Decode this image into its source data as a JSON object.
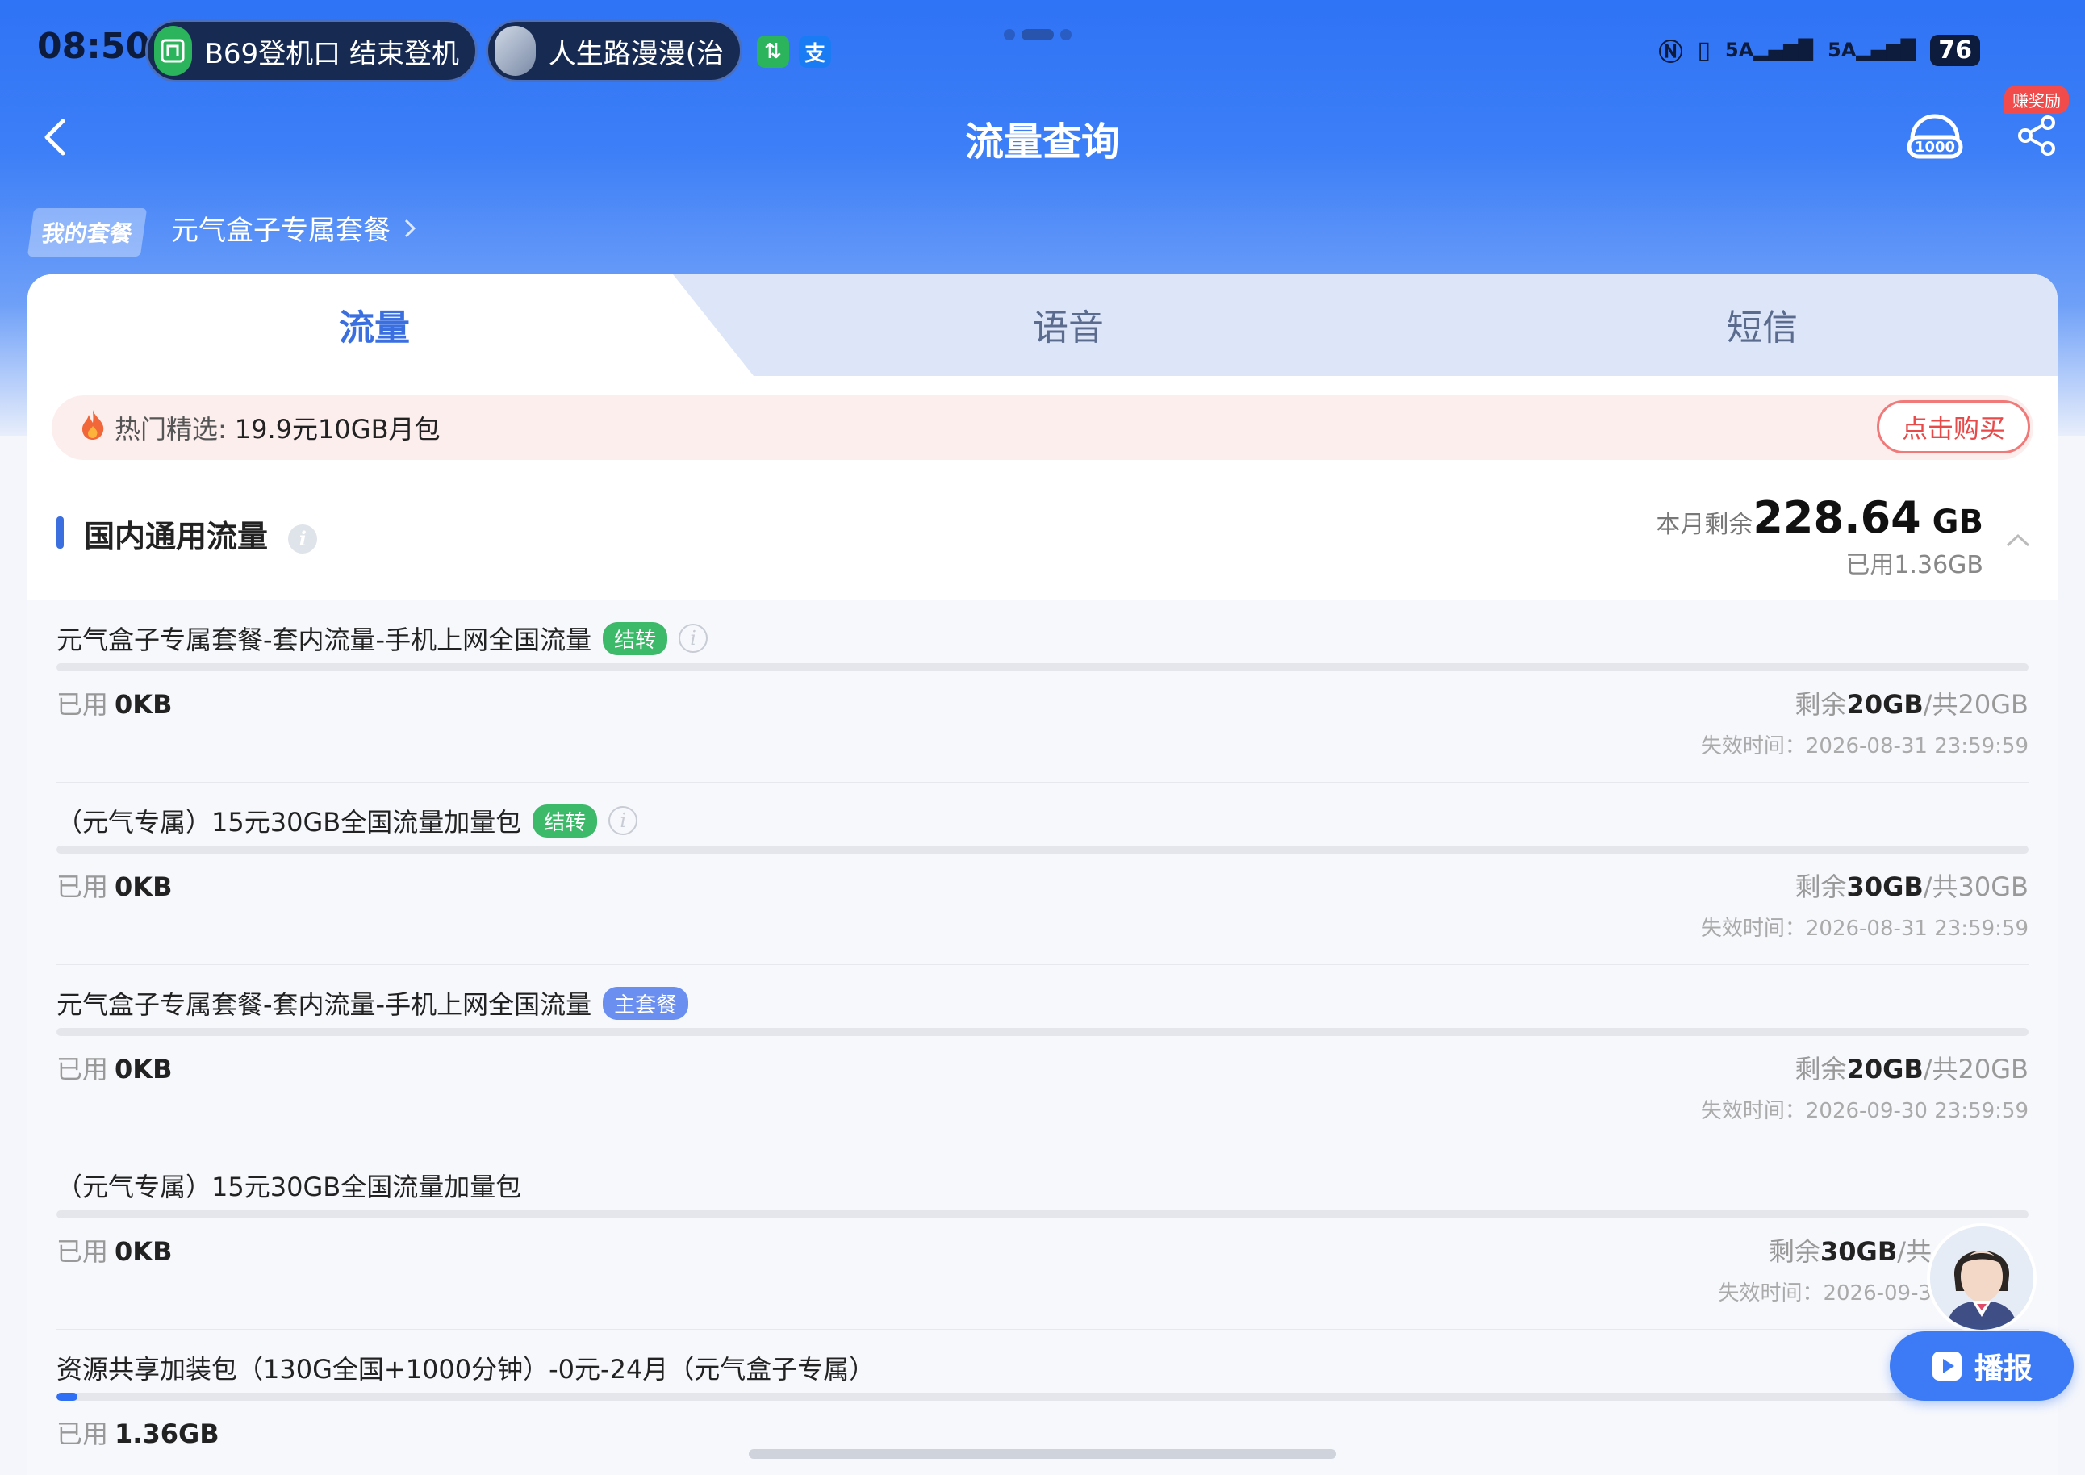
{
  "status_bar": {
    "time": "08:50",
    "pill1_text": "B69登机口  结束登机",
    "pill2_text": "人生路漫漫(治",
    "battery": "76"
  },
  "header": {
    "title": "流量查询",
    "reward_badge": "赚奖励"
  },
  "plan": {
    "tag": "我的套餐",
    "name": "元气盒子专属套餐"
  },
  "tabs": [
    {
      "label": "流量"
    },
    {
      "label": "语音"
    },
    {
      "label": "短信"
    }
  ],
  "promo": {
    "label": "热门精选:",
    "value": "19.9元10GB月包",
    "button": "点击购买"
  },
  "section": {
    "title": "国内通用流量",
    "remain_label": "本月剩余",
    "remain_value": "228.64",
    "remain_unit": " GB",
    "used_total": "已用1.36GB"
  },
  "items": [
    {
      "title": "元气盒子专属套餐-套内流量-手机上网全国流量",
      "badge": "结转",
      "used_label": "已用",
      "used_value": "0KB",
      "remain_label": "剩余",
      "remain_value": "20GB",
      "total": "/共20GB",
      "expire": "失效时间：2026-08-31 23:59:59",
      "progress": 0
    },
    {
      "title": "（元气专属）15元30GB全国流量加量包",
      "badge": "结转",
      "used_label": "已用",
      "used_value": "0KB",
      "remain_label": "剩余",
      "remain_value": "30GB",
      "total": "/共30GB",
      "expire": "失效时间：2026-08-31 23:59:59",
      "progress": 0
    },
    {
      "title": "元气盒子专属套餐-套内流量-手机上网全国流量",
      "badge": "主套餐",
      "used_label": "已用",
      "used_value": "0KB",
      "remain_label": "剩余",
      "remain_value": "20GB",
      "total": "/共20GB",
      "expire": "失效时间：2026-09-30 23:59:59",
      "progress": 0
    },
    {
      "title": "（元气专属）15元30GB全国流量加量包",
      "used_label": "已用",
      "used_value": "0KB",
      "remain_label": "剩余",
      "remain_value": "30GB",
      "total": "/共",
      "expire": "失效时间：2026-09-3",
      "progress": 0
    },
    {
      "title": "资源共享加装包（130G全国+1000分钟）-0元-24月（元气盒子专属）",
      "used_label": "已用",
      "used_value": "1.36GB",
      "progress": 0.0105
    }
  ],
  "assistant": {
    "button": "播报"
  }
}
